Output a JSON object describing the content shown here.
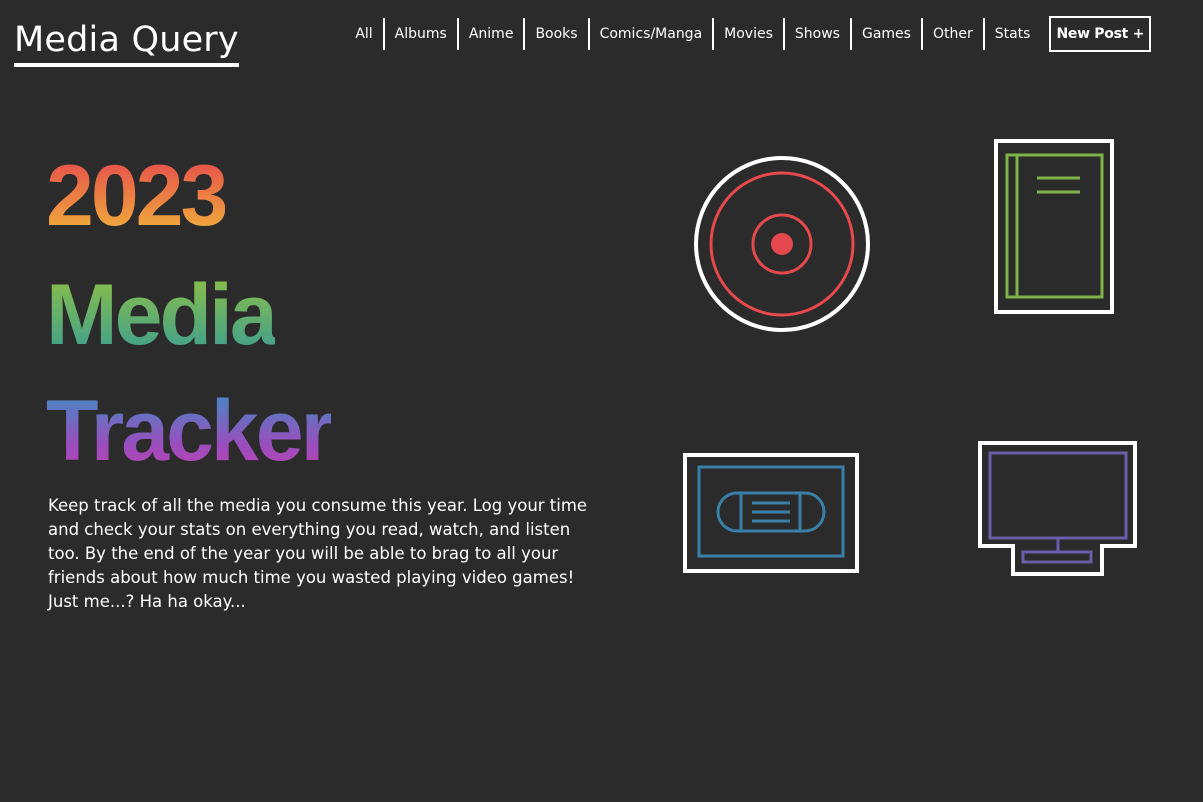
{
  "header": {
    "logo": "Media Query",
    "nav": [
      "All",
      "Albums",
      "Anime",
      "Books",
      "Comics/Manga",
      "Movies",
      "Shows",
      "Games",
      "Other",
      "Stats"
    ],
    "new_post_label": "New Post +"
  },
  "hero": {
    "line1": "2023",
    "line2": "Media",
    "line3": "Tracker",
    "description": "Keep track of all the media you consume this year. Log your time and check your stats on everything you read, watch, and listen too. By the end of the year you will be able to brag to all your friends about how much time you wasted playing video games! Just me...? Ha ha okay..."
  },
  "icons": [
    {
      "name": "disc-icon",
      "color": "#e5484d"
    },
    {
      "name": "book-icon",
      "color": "#7fb34a"
    },
    {
      "name": "vhs-tape-icon",
      "color": "#3a7fa8"
    },
    {
      "name": "tv-monitor-icon",
      "color": "#6a5ea8"
    }
  ],
  "colors": {
    "background": "#2b2b2b",
    "foreground": "#ffffff",
    "gradient_2023": [
      "#e5484d",
      "#f0a93c"
    ],
    "gradient_media": [
      "#8fbf45",
      "#3fa08e"
    ],
    "gradient_tracker": [
      "#3c8fc4",
      "#c43fae"
    ]
  }
}
